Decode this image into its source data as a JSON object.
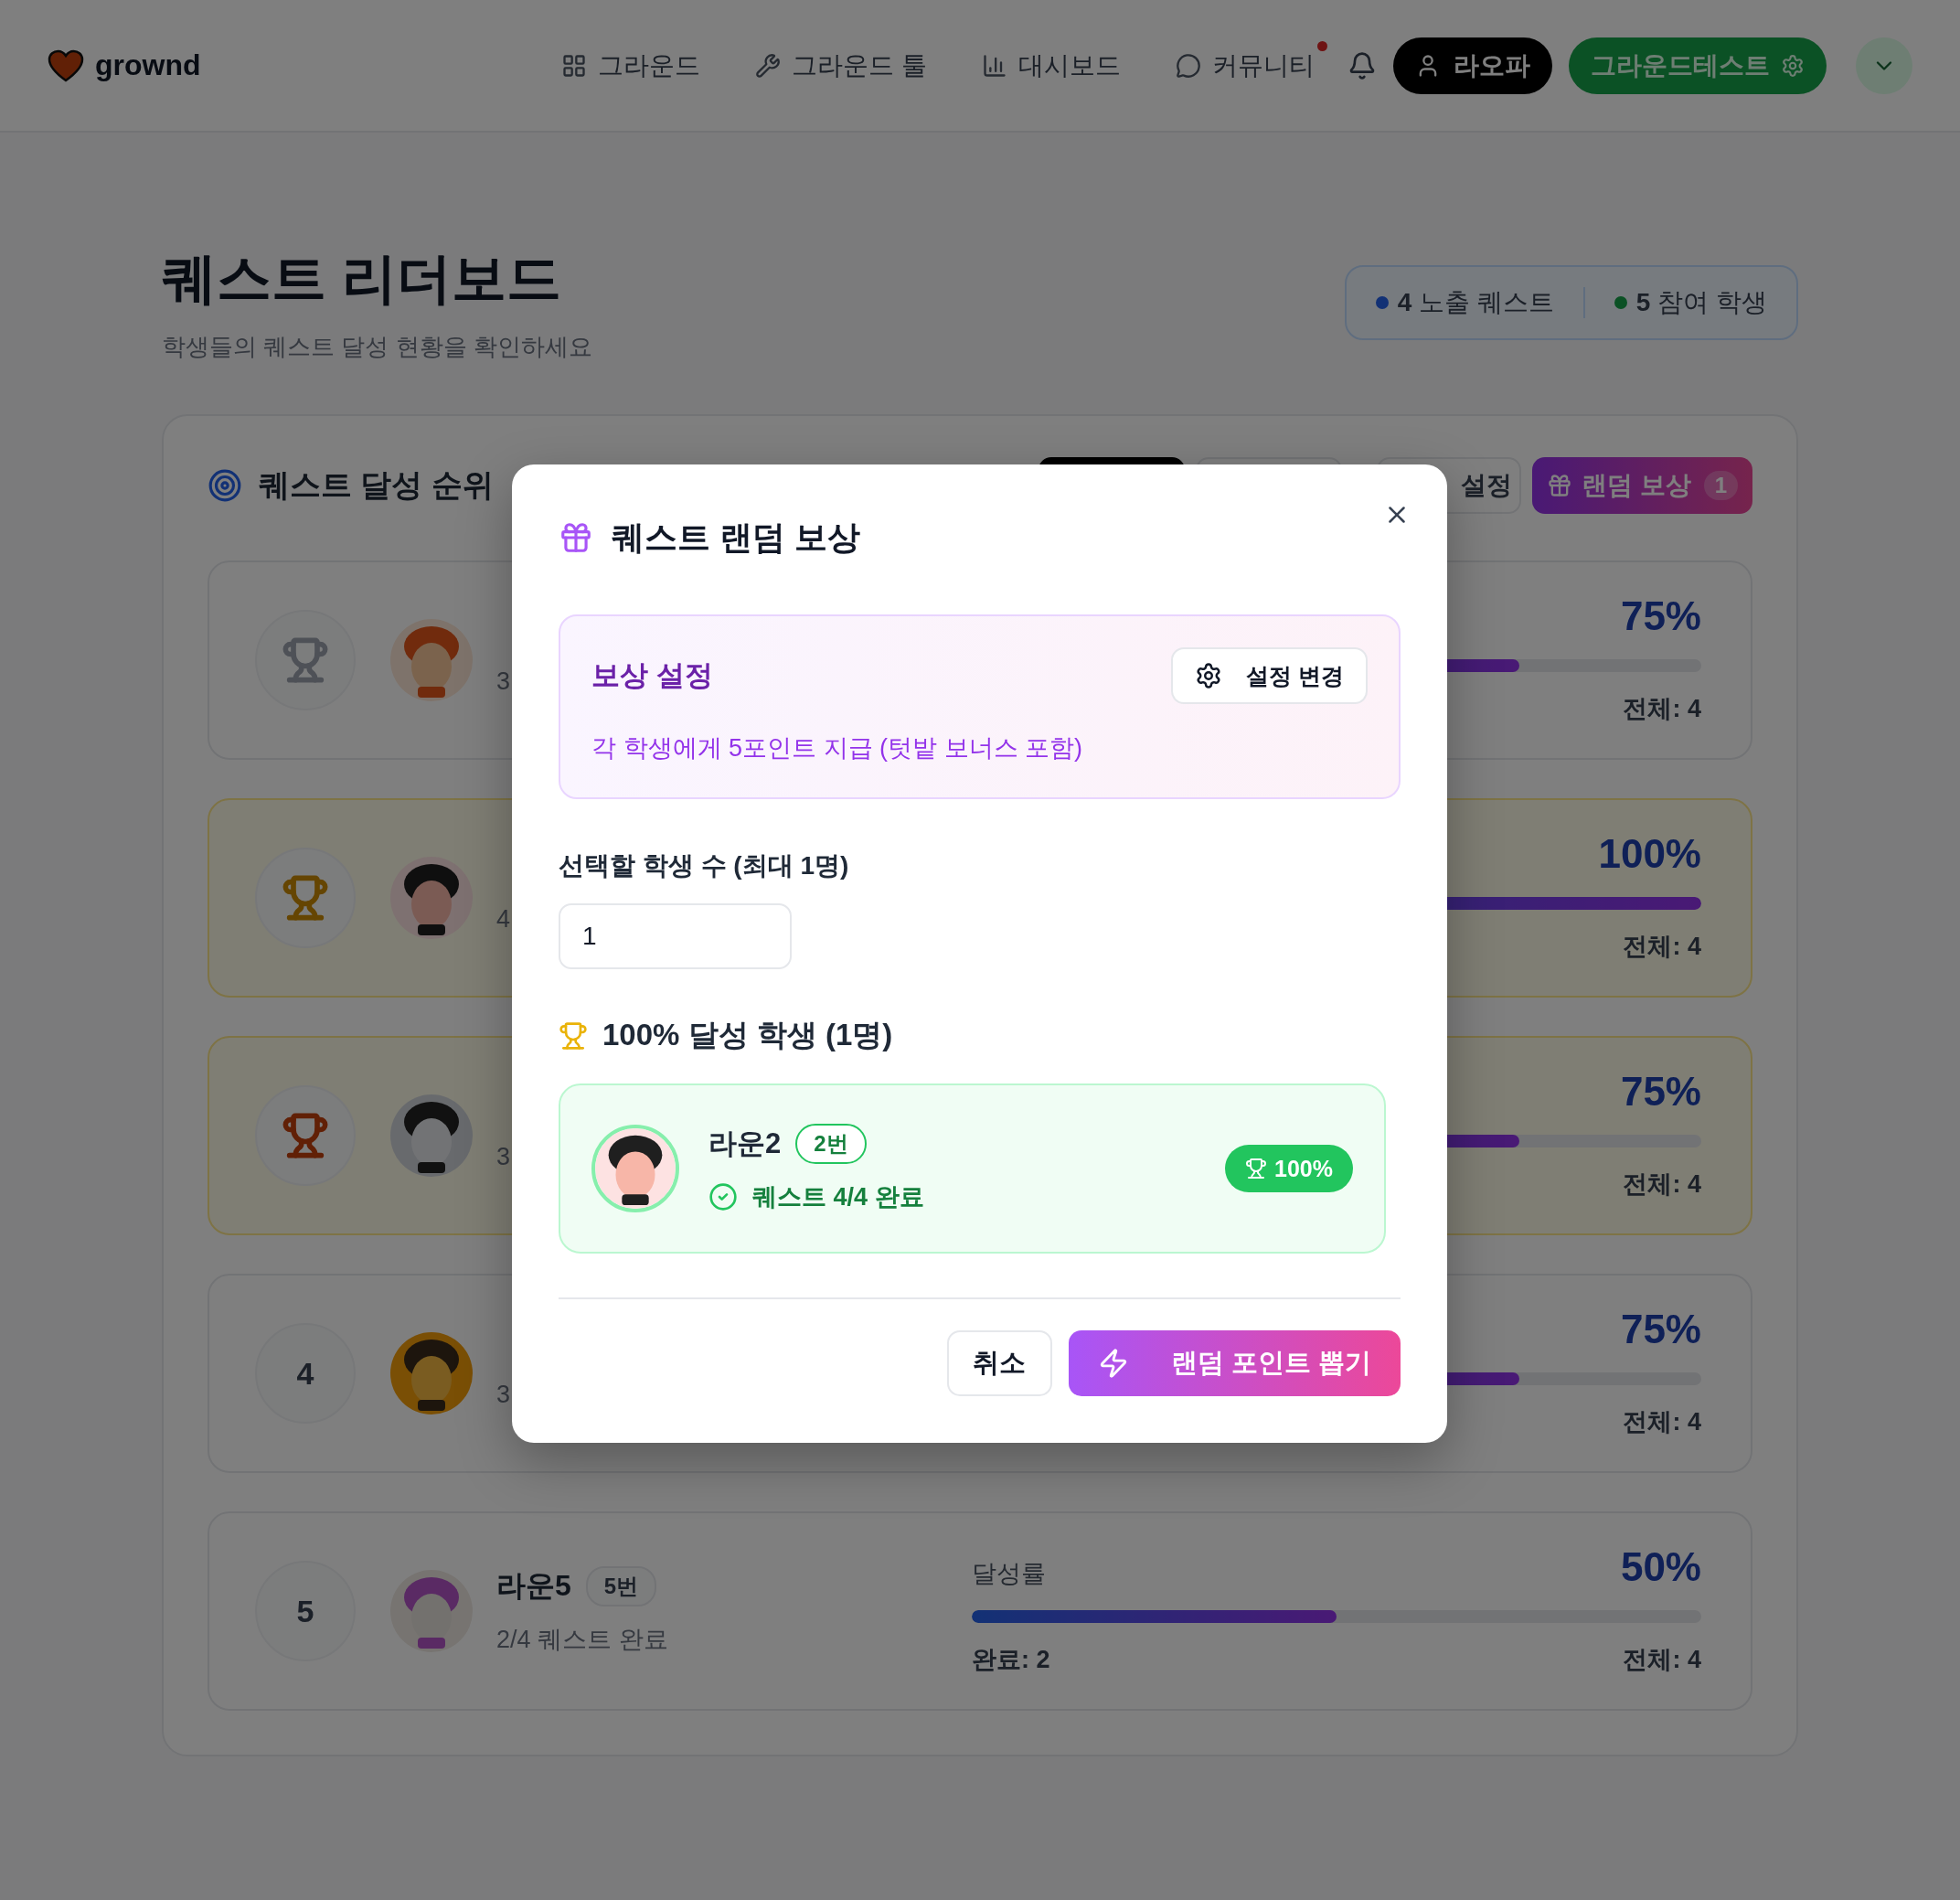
{
  "header": {
    "logo": "grownd",
    "nav": [
      {
        "label": "그라운드"
      },
      {
        "label": "그라운드 툴"
      },
      {
        "label": "대시보드"
      },
      {
        "label": "커뮤니티"
      }
    ],
    "notification_unread": true,
    "user_button": "라오파",
    "class_button": "그라운드테스트"
  },
  "page": {
    "title": "퀘스트 리더보드",
    "subtitle": "학생들의 퀘스트 달성 현황을 확인하세요",
    "stats": [
      {
        "value": "4",
        "label": "노출 퀘스트",
        "color": "#123175"
      },
      {
        "value": "5",
        "label": "참여 학생",
        "color": "#0b5125"
      }
    ]
  },
  "leaderboard": {
    "title": "퀘스트 달성 순위",
    "settings_button": "설정",
    "random_button": {
      "label": "랜덤 보상",
      "count": "1"
    },
    "rows": [
      {
        "kind": "trophy",
        "color": "#4e5157",
        "highlighted": false,
        "progress_visible": "3",
        "percent": "75%",
        "level": 0.75,
        "total": "전체: 4"
      },
      {
        "kind": "trophy",
        "color": "#654502",
        "highlighted": true,
        "progress_visible": "4",
        "percent": "100%",
        "level": 1,
        "total": "전체: 4"
      },
      {
        "kind": "trophy",
        "color": "#612006",
        "highlighted": true,
        "progress_visible": "3",
        "percent": "75%",
        "level": 0.75,
        "total": "전체: 4"
      },
      {
        "kind": "number",
        "rank": "4",
        "highlighted": false,
        "progress_visible": "3",
        "percent": "75%",
        "level": 0.75,
        "total": "전체: 4"
      },
      {
        "kind": "number",
        "rank": "5",
        "highlighted": false,
        "name": "라운5",
        "number": "5번",
        "progress": "2/4 퀘스트 완료",
        "rate_label": "달성률",
        "percent": "50%",
        "level": 0.5,
        "done": "완료: 2",
        "total": "전체: 4"
      }
    ]
  },
  "modal": {
    "title": "퀘스트 랜덤 보상",
    "reward": {
      "title": "보상 설정",
      "description": "각 학생에게 5포인트 지급 (텃밭 보너스 포함)",
      "button": "설정 변경"
    },
    "count_label": "선택할 학생 수 (최대 1명)",
    "count_value": "1",
    "section_title": "100% 달성 학생 (1명)",
    "students": [
      {
        "name": "라운2",
        "number": "2번",
        "progress": "퀘스트 4/4 완료",
        "percent": "100%"
      }
    ],
    "cancel": "취소",
    "confirm": "랜덤 포인트 뽑기"
  }
}
